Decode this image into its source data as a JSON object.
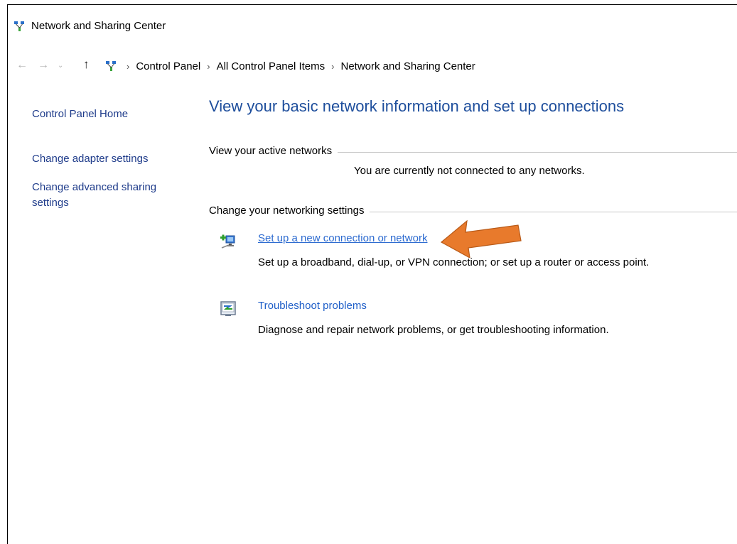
{
  "window": {
    "title": "Network and Sharing Center"
  },
  "address_bar": {
    "back_icon": "back-arrow-icon",
    "forward_icon": "forward-arrow-icon",
    "recent_icon": "chevron-down-icon",
    "up_icon": "up-arrow-icon",
    "separator": "›",
    "breadcrumbs": [
      "Control Panel",
      "All Control Panel Items",
      "Network and Sharing Center"
    ]
  },
  "sidebar": {
    "items": [
      {
        "label": "Control Panel Home"
      },
      {
        "label": "Change adapter settings"
      },
      {
        "label": "Change advanced sharing settings"
      }
    ]
  },
  "main": {
    "heading": "View your basic network information and set up connections",
    "active_networks": {
      "title": "View your active networks",
      "message": "You are currently not connected to any networks."
    },
    "change_settings": {
      "title": "Change your networking settings",
      "tasks": [
        {
          "icon": "new-connection-icon",
          "label": "Set up a new connection or network",
          "description": "Set up a broadband, dial-up, or VPN connection; or set up a router or access point."
        },
        {
          "icon": "troubleshoot-icon",
          "label": "Troubleshoot problems",
          "description": "Diagnose and repair network problems, or get troubleshooting information."
        }
      ]
    }
  },
  "annotation": {
    "callout_color": "#e87a2c",
    "callout_icon": "callout-arrow-icon"
  },
  "colors": {
    "link": "#1e5ec8",
    "heading": "#1e4e9c",
    "sidebar_link": "#1e3b8a"
  }
}
